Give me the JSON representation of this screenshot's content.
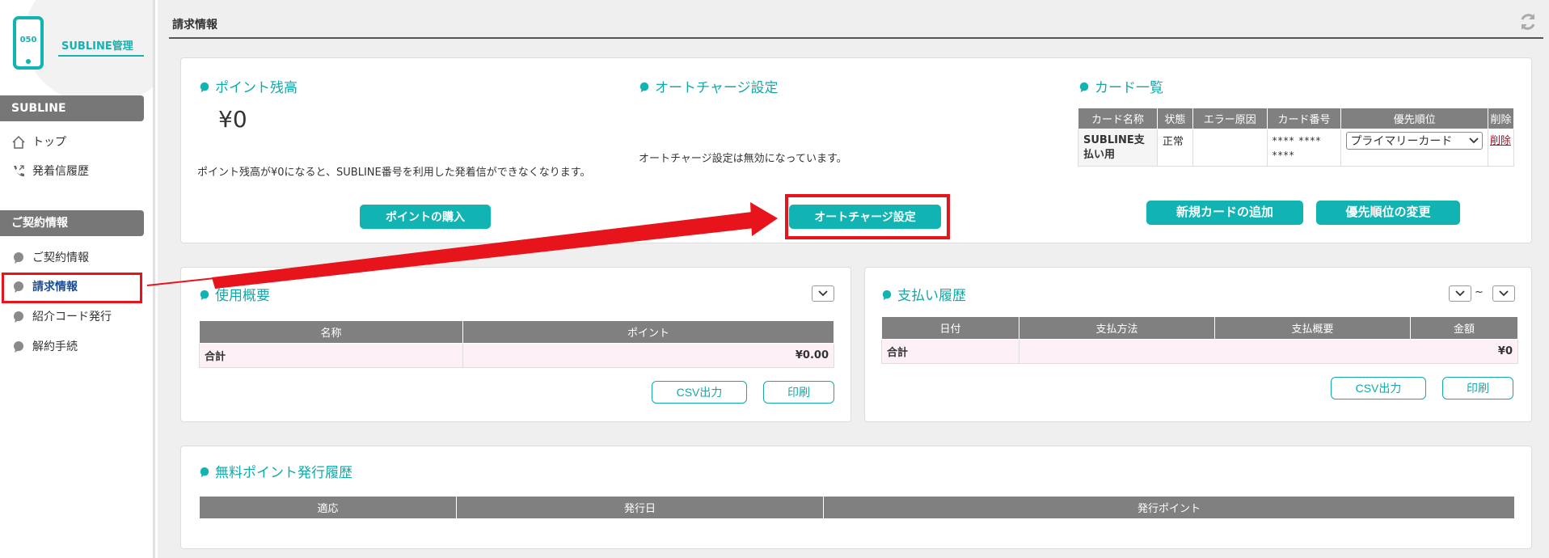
{
  "sidebar": {
    "logo_number": "050",
    "logo_title": "SUBLINE管理",
    "section1_header": "SUBLINE",
    "section1_items": [
      {
        "label": "トップ"
      },
      {
        "label": "発着信履歴"
      }
    ],
    "section2_header": "ご契約情報",
    "section2_items": [
      {
        "label": "ご契約情報"
      },
      {
        "label": "請求情報"
      },
      {
        "label": "紹介コード発行"
      },
      {
        "label": "解約手続"
      }
    ]
  },
  "header": {
    "title": "請求情報"
  },
  "points": {
    "title": "ポイント残高",
    "balance": "¥0",
    "note": "ポイント残高が¥0になると、SUBLINE番号を利用した発着信ができなくなります。",
    "buy_button": "ポイントの購入"
  },
  "autocharge": {
    "title": "オートチャージ設定",
    "status": "オートチャージ設定は無効になっています。",
    "button": "オートチャージ設定"
  },
  "cards": {
    "title": "カード一覧",
    "columns": [
      "カード名称",
      "状態",
      "エラー原因",
      "カード番号",
      "優先順位",
      "削除"
    ],
    "rows": [
      {
        "name_line1": "SUBLINE支",
        "name_line2": "払い用",
        "status": "正常",
        "error": "",
        "number_line1": "**** ****",
        "number_line2": "****",
        "priority": "プライマリーカード",
        "delete": "削除"
      }
    ],
    "add_button": "新規カードの追加",
    "priority_button": "優先順位の変更"
  },
  "usage": {
    "title": "使用概要",
    "columns": [
      "名称",
      "ポイント"
    ],
    "total_label": "合計",
    "total_value": "¥0.00",
    "csv_button": "CSV出力",
    "print_button": "印刷"
  },
  "payments": {
    "title": "支払い履歴",
    "range_sep": "~",
    "columns": [
      "日付",
      "支払方法",
      "支払概要",
      "金額"
    ],
    "total_label": "合計",
    "total_value": "¥0",
    "csv_button": "CSV出力",
    "print_button": "印刷"
  },
  "free_points": {
    "title": "無料ポイント発行履歴",
    "columns": [
      "適応",
      "発行日",
      "発行ポイント"
    ]
  },
  "colors": {
    "accent": "#12b3b3",
    "highlight": "#e8141b",
    "table_header": "#808080"
  }
}
